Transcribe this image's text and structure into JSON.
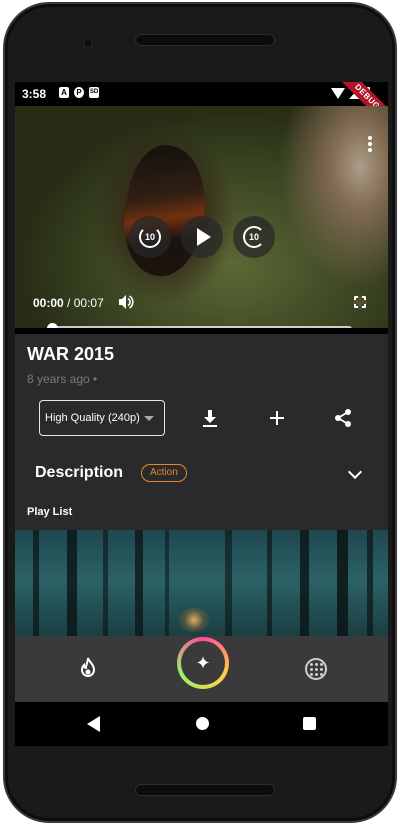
{
  "status_bar": {
    "time": "3:58",
    "left_icons": [
      "A",
      "P",
      "SD"
    ],
    "debug_label": "DEBUG"
  },
  "player": {
    "current_time": "00:00",
    "separator": " / ",
    "duration": "00:07",
    "rewind_seconds": "10",
    "forward_seconds": "10",
    "progress": 0
  },
  "video": {
    "title": "WAR 2015",
    "subtitle": "8 years ago •"
  },
  "actions": {
    "quality_value": "High Quality (240p)",
    "download_icon": "download-icon",
    "add_icon": "add-icon",
    "share_icon": "share-icon"
  },
  "description": {
    "title": "Description",
    "badge": "Action"
  },
  "playlist": {
    "title": "Play List"
  },
  "bottom_nav": {
    "items": [
      "fire-icon",
      "sparkle-icon",
      "grid-icon"
    ]
  },
  "colors": {
    "background": "#2a2a2c",
    "accent_orange": "#e0892a",
    "debug_red": "#b0172a"
  }
}
